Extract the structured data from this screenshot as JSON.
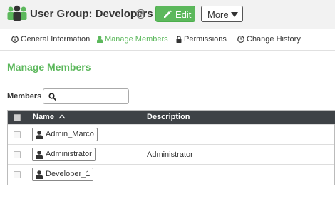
{
  "header": {
    "title": "User Group: Developers",
    "help_symbol": "?",
    "edit_label": "Edit",
    "more_label": "More"
  },
  "tabs": [
    {
      "label": "General Information",
      "icon": "info-icon"
    },
    {
      "label": "Manage Members",
      "icon": "user-icon",
      "active": true
    },
    {
      "label": "Permissions",
      "icon": "lock-icon"
    },
    {
      "label": "Change History",
      "icon": "clock-icon"
    }
  ],
  "section_title": "Manage Members",
  "members": {
    "label": "Members",
    "search_value": "",
    "search_placeholder": ""
  },
  "table": {
    "columns": [
      "Name",
      "Description"
    ],
    "rows": [
      {
        "name": "Admin_Marco",
        "description": ""
      },
      {
        "name": "Administrator",
        "description": "Administrator"
      },
      {
        "name": "Developer_1",
        "description": ""
      }
    ]
  },
  "colors": {
    "accent": "#5cb85c",
    "table_header": "#3e4246"
  }
}
